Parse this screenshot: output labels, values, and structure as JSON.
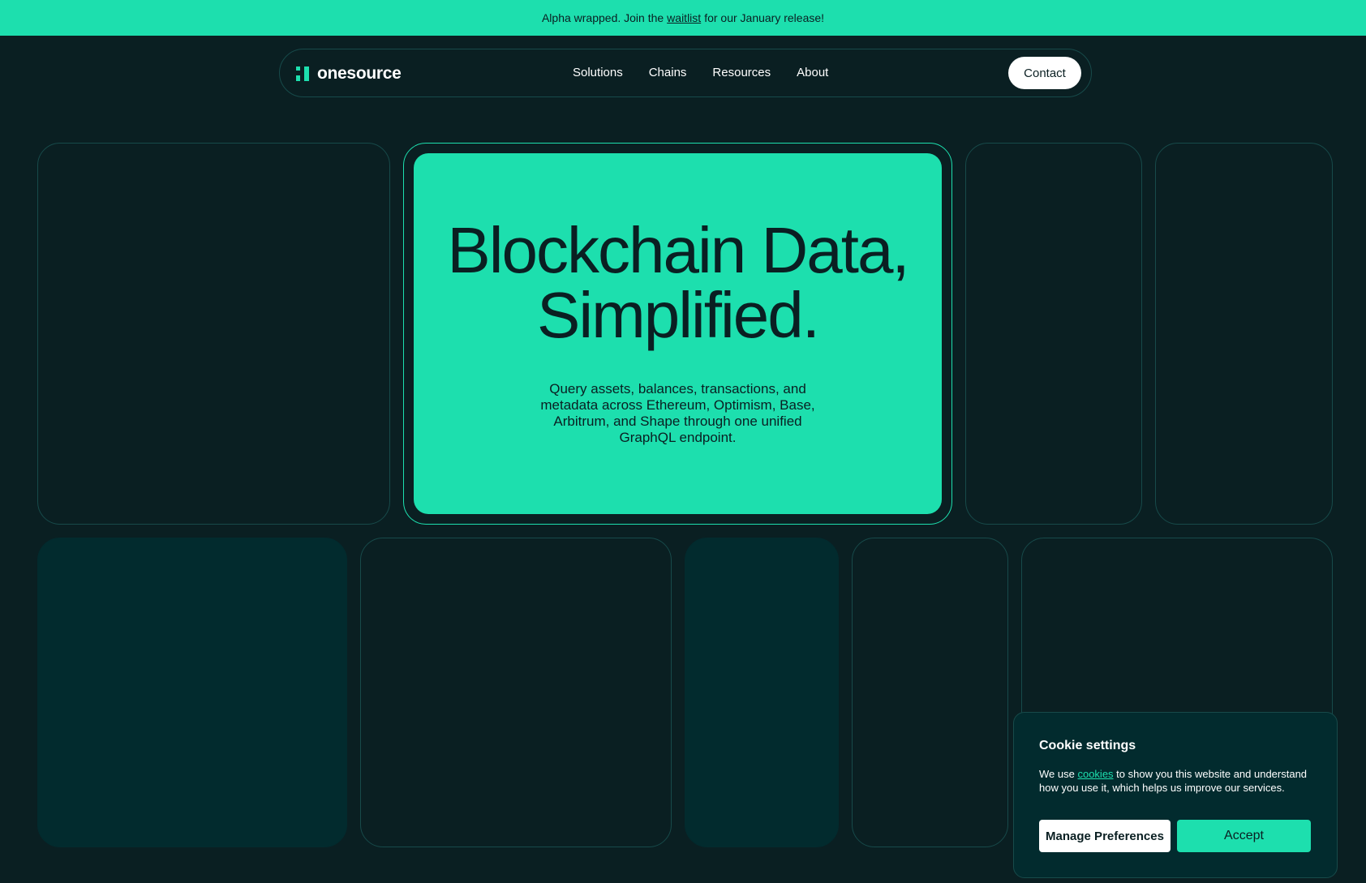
{
  "banner": {
    "text_before": "Alpha wrapped. Join the",
    "link": "waitlist",
    "text_after": "for our January release!"
  },
  "nav": {
    "logo": "onesource",
    "links": [
      "Solutions",
      "Chains",
      "Resources",
      "About"
    ],
    "contact": "Contact"
  },
  "hero": {
    "title_line1": "Blockchain Data,",
    "title_line2": "Simplified.",
    "subtitle": "Query assets, balances, transactions, and metadata across Ethereum, Optimism, Base, Arbitrum, and Shape through one unified GraphQL endpoint."
  },
  "cookie": {
    "title": "Cookie settings",
    "text_before": "We use",
    "link": "cookies",
    "text_after": "to show you this website and understand how you use it, which helps us improve our services.",
    "manage": "Manage Preferences",
    "accept": "Accept"
  },
  "colors": {
    "background": "#0a1f22",
    "accent": "#1ddfae",
    "panel": "#022b2e",
    "border": "#174a4a"
  }
}
